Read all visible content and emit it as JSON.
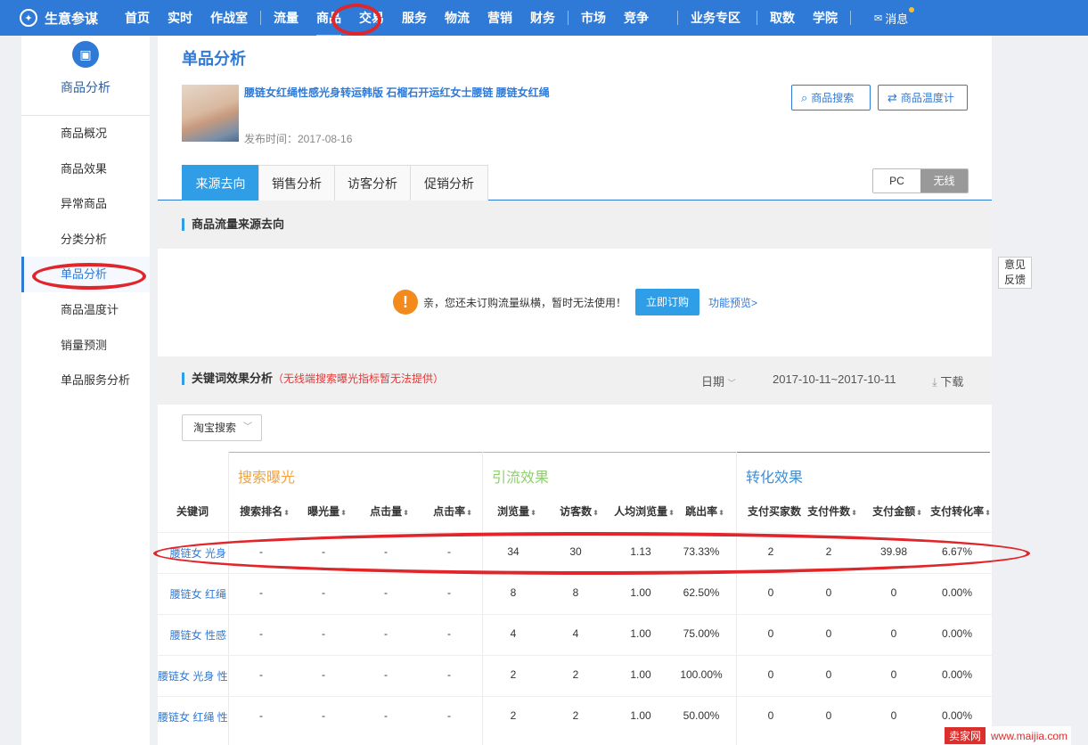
{
  "nav": {
    "brand": "生意参谋",
    "items": [
      "首页",
      "实时",
      "作战室",
      "流量",
      "商品",
      "交易",
      "服务",
      "物流",
      "营销",
      "财务",
      "市场",
      "竞争",
      "业务专区",
      "取数",
      "学院"
    ],
    "message": "消息"
  },
  "sidebar": {
    "title": "商品分析",
    "items": [
      "商品概况",
      "商品效果",
      "异常商品",
      "分类分析",
      "单品分析",
      "商品温度计",
      "销量预测",
      "单品服务分析"
    ]
  },
  "page": {
    "title": "单品分析",
    "product_name": "腰链女红绳性感光身转运韩版 石榴石开运红女士腰链 腰链女红绳",
    "publish_time": "发布时间：2017-08-16",
    "search_button": "商品搜索",
    "thermometer_button": "商品温度计"
  },
  "tabs": [
    "来源去向",
    "销售分析",
    "访客分析",
    "促销分析"
  ],
  "device": [
    "PC",
    "无线"
  ],
  "traffic_section": {
    "title": "商品流量来源去向",
    "notice": "亲，您还未订购流量纵横，暂时无法使用！",
    "buy_button": "立即订购",
    "preview_link": "功能预览>"
  },
  "keyword_section": {
    "title": "关键词效果分析",
    "note": "（无线端搜索曝光指标暂无法提供）",
    "date_label": "日期",
    "date_range": "2017-10-11~2017-10-11",
    "download": "下载",
    "source_select": "淘宝搜索"
  },
  "table": {
    "groups": [
      "搜索曝光",
      "引流效果",
      "转化效果"
    ],
    "headers": [
      "关键词",
      "搜索排名",
      "曝光量",
      "点击量",
      "点击率",
      "浏览量",
      "访客数",
      "人均浏览量",
      "跳出率",
      "支付买家数",
      "支付件数",
      "支付金额",
      "支付转化率"
    ],
    "rows": [
      [
        "腰链女 光身",
        "-",
        "-",
        "-",
        "-",
        "34",
        "30",
        "1.13",
        "73.33%",
        "2",
        "2",
        "39.98",
        "6.67%"
      ],
      [
        "腰链女 红绳",
        "-",
        "-",
        "-",
        "-",
        "8",
        "8",
        "1.00",
        "62.50%",
        "0",
        "0",
        "0",
        "0.00%"
      ],
      [
        "腰链女 性感",
        "-",
        "-",
        "-",
        "-",
        "4",
        "4",
        "1.00",
        "75.00%",
        "0",
        "0",
        "0",
        "0.00%"
      ],
      [
        "腰链女 光身 性",
        "-",
        "-",
        "-",
        "-",
        "2",
        "2",
        "1.00",
        "100.00%",
        "0",
        "0",
        "0",
        "0.00%"
      ],
      [
        "腰链女 红绳 性",
        "-",
        "-",
        "-",
        "-",
        "2",
        "2",
        "1.00",
        "50.00%",
        "0",
        "0",
        "0",
        "0.00%"
      ]
    ]
  },
  "feedback": [
    "意见",
    "反馈"
  ],
  "watermark": {
    "badge": "卖家网",
    "url": "www.maijia.com"
  },
  "colors": {
    "nav": "#2f7ad6",
    "accent": "#2f9ee6",
    "orange_group": "#f2a33c",
    "green_group": "#8fcf6e",
    "blue_group": "#3d8fd6",
    "annotation": "#e0262a"
  }
}
